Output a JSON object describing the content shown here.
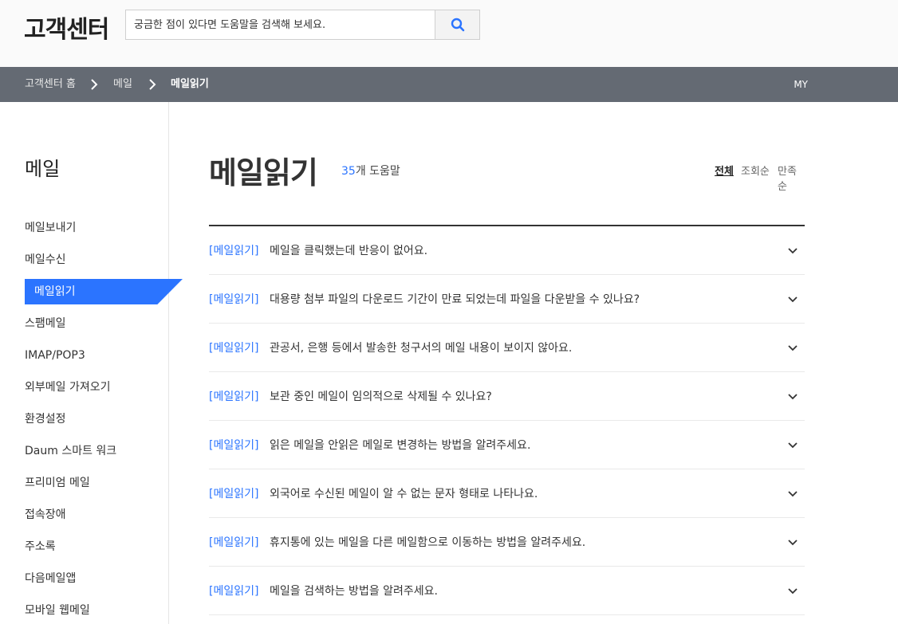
{
  "header": {
    "logo": "고객센터",
    "search": {
      "placeholder": "궁금한 점이 있다면 도움말을 검색해 보세요."
    }
  },
  "breadcrumb": {
    "items": [
      "고객센터 홈",
      "메일",
      "메일읽기"
    ],
    "my_label": "MY"
  },
  "sidebar": {
    "title": "메일",
    "items": [
      {
        "label": "메일보내기"
      },
      {
        "label": "메일수신"
      },
      {
        "label": "메일읽기",
        "active": true
      },
      {
        "label": "스팸메일"
      },
      {
        "label": "IMAP/POP3"
      },
      {
        "label": "외부메일 가져오기"
      },
      {
        "label": "환경설정"
      },
      {
        "label": "Daum 스마트 워크"
      },
      {
        "label": "프리미엄 메일"
      },
      {
        "label": "접속장애"
      },
      {
        "label": "주소록"
      },
      {
        "label": "다음메일앱"
      },
      {
        "label": "모바일 웹메일"
      }
    ]
  },
  "main": {
    "title": "메일읽기",
    "count_num": "35",
    "count_suffix": "개 도움말",
    "sort": [
      {
        "label": "전체",
        "active": true
      },
      {
        "label": "조회순"
      },
      {
        "label": "만족순"
      }
    ],
    "questions": [
      {
        "category": "[메일읽기]",
        "text": "메일을 클릭했는데 반응이 없어요."
      },
      {
        "category": "[메일읽기]",
        "text": "대용량 첨부 파일의 다운로드 기간이 만료 되었는데 파일을 다운받을 수 있나요?"
      },
      {
        "category": "[메일읽기]",
        "text": "관공서, 은행 등에서 발송한 청구서의 메일 내용이 보이지 않아요."
      },
      {
        "category": "[메일읽기]",
        "text": "보관 중인 메일이 임의적으로 삭제될 수 있나요?"
      },
      {
        "category": "[메일읽기]",
        "text": "읽은 메일을 안읽은 메일로 변경하는 방법을 알려주세요."
      },
      {
        "category": "[메일읽기]",
        "text": "외국어로 수신된 메일이 알 수 없는 문자 형태로 나타나요."
      },
      {
        "category": "[메일읽기]",
        "text": "휴지통에 있는 메일을 다른 메일함으로 이동하는 방법을 알려주세요."
      },
      {
        "category": "[메일읽기]",
        "text": "메일을 검색하는 방법을 알려주세요."
      }
    ]
  },
  "colors": {
    "accent": "#2b74ff",
    "navbar": "#646a73"
  }
}
